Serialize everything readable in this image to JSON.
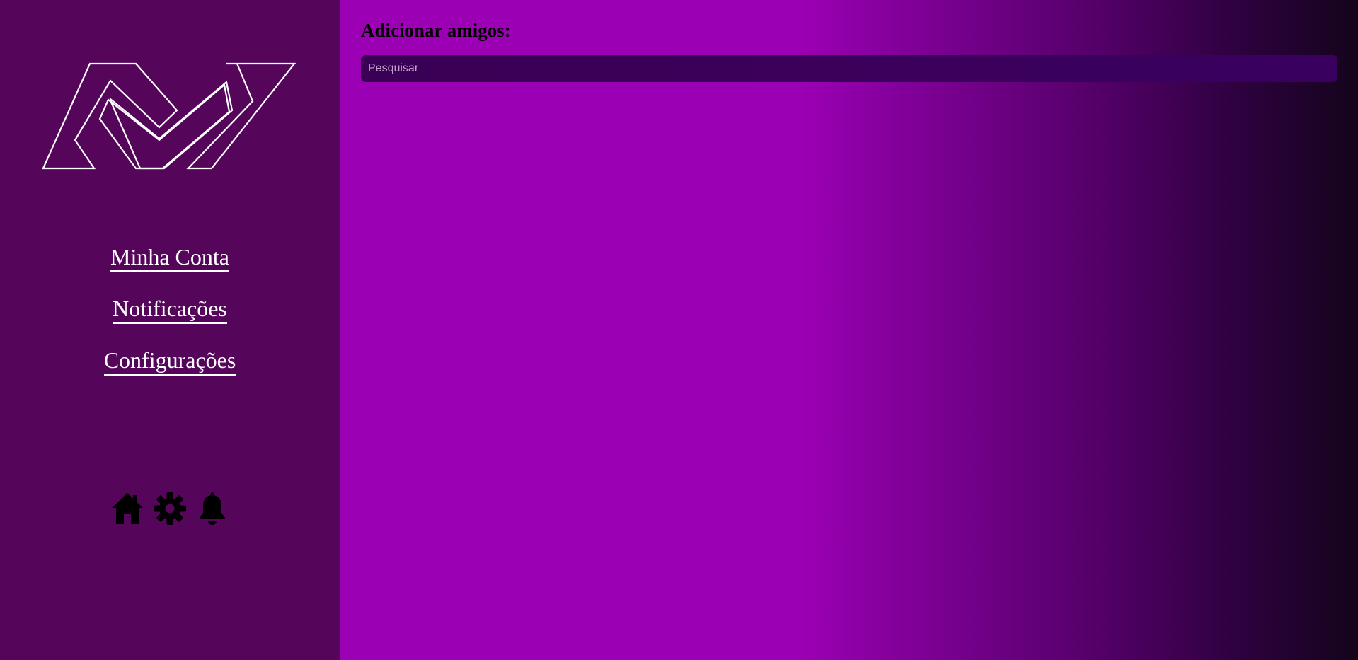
{
  "sidebar": {
    "logo_icon": "stylized-n-logo-outline",
    "nav": [
      {
        "label": "Minha Conta"
      },
      {
        "label": "Notificações"
      },
      {
        "label": "Configurações"
      }
    ],
    "icons": [
      "home-icon",
      "gear-icon",
      "bell-icon"
    ]
  },
  "main": {
    "title": "Adicionar amigos:",
    "search": {
      "placeholder": "Pesquisar",
      "value": ""
    }
  },
  "colors": {
    "sidebar_bg": "#55065b",
    "main_bg": "#9c00b4",
    "search_bg": "#3a0055"
  }
}
